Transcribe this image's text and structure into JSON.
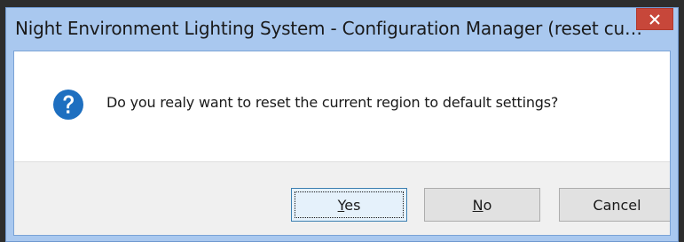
{
  "window": {
    "title": "Night Environment Lighting System - Configuration Manager (reset current region)"
  },
  "close_icon": "close-x-icon",
  "message": {
    "icon": "question-icon",
    "text": "Do you realy want to reset the current region to default settings?"
  },
  "buttons": {
    "yes": {
      "mnemonic": "Y",
      "rest": "es"
    },
    "no": {
      "mnemonic": "N",
      "rest": "o"
    },
    "cancel": {
      "label": "Cancel"
    }
  },
  "colors": {
    "titlebar": "#a9c8ef",
    "close_button": "#c7473a",
    "question_icon": "#1e6fc0",
    "button_face": "#e1e1e1",
    "default_button_border": "#3c7fb1"
  }
}
